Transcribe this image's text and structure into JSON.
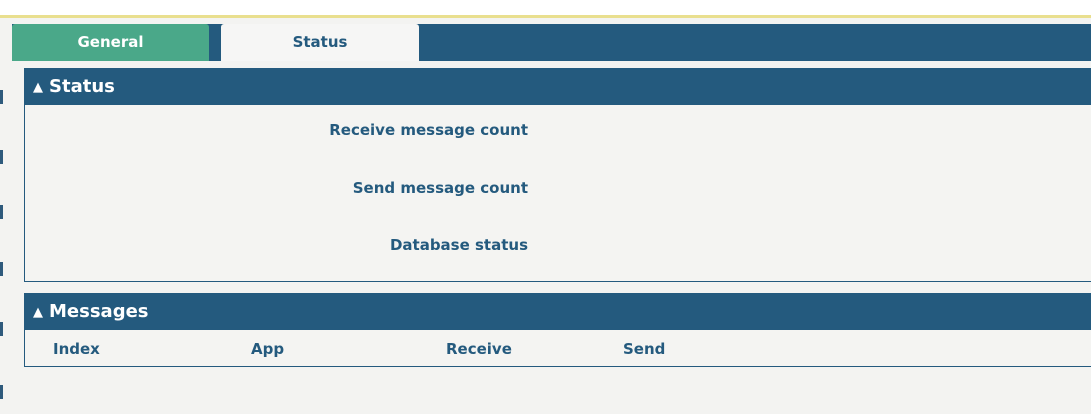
{
  "tabs": {
    "general": "General",
    "status": "Status"
  },
  "status_panel": {
    "title": "Status",
    "fields": {
      "receive_count_label": "Receive message count",
      "send_count_label": "Send message count",
      "database_status_label": "Database status"
    }
  },
  "messages_panel": {
    "title": "Messages",
    "columns": {
      "index": "Index",
      "app": "App",
      "receive": "Receive",
      "send": "Send"
    }
  },
  "icons": {
    "collapse": "chevron-up-icon"
  },
  "colors": {
    "header": "#245a7e",
    "active_tab": "#4aa889",
    "label": "#245a7e"
  }
}
